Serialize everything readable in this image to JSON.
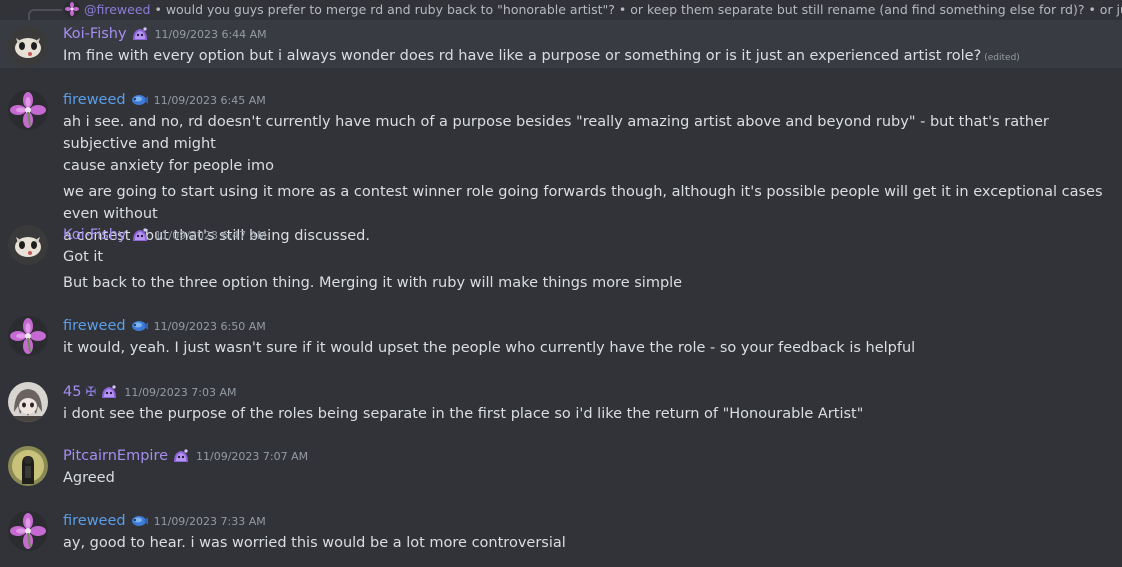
{
  "reply": {
    "author": "@fireweed",
    "text": "• would you guys prefer to merge rd and ruby back to \"honorable artist\"?  • or keep them separate but still rename (and find something else for rd)?  • or just leave it"
  },
  "messages": [
    {
      "author": "Koi-Fishy",
      "timestamp": "11/09/2023 6:44 AM",
      "lines": [
        "Im fine with every option but i always wonder does rd have like a purpose or something or is it just an experienced artist role?"
      ],
      "edited": "(edited)"
    },
    {
      "author": "fireweed",
      "timestamp": "11/09/2023 6:45 AM",
      "lines": [
        "ah i see. and no, rd doesn't currently have much of a purpose besides \"really amazing artist above and beyond ruby\" - but that's rather subjective and might",
        "cause anxiety for people imo",
        "we are going to start using it more as a contest winner role going forwards though, although it's possible people will get it in exceptional cases even without",
        "a contest - but that's still being discussed."
      ]
    },
    {
      "author": "Koi-Fishy",
      "timestamp": "11/09/2023 6:47 AM",
      "lines": [
        "Got it",
        "But back to the three option thing. Merging it with ruby will make things more simple"
      ]
    },
    {
      "author": "fireweed",
      "timestamp": "11/09/2023 6:50 AM",
      "lines": [
        "it would, yeah. I just wasn't sure if it would upset the people who currently have the role - so your feedback is helpful"
      ]
    },
    {
      "author": "45",
      "author_symbol": "✠",
      "timestamp": "11/09/2023 7:03 AM",
      "lines": [
        "i dont see the purpose of the roles being separate in the first place so i'd like the return of \"Honourable Artist\""
      ]
    },
    {
      "author": "PitcairnEmpire",
      "timestamp": "11/09/2023 7:07 AM",
      "lines": [
        "Agreed"
      ]
    },
    {
      "author": "fireweed",
      "timestamp": "11/09/2023 7:33 AM",
      "lines": [
        "ay, good to hear. i was worried this would be a lot more controversial"
      ]
    }
  ],
  "colors": {
    "background": "#313338",
    "highlight": "#393b43",
    "fireweed": "#5b9ee8",
    "koi_fishy": "#a58ef0",
    "timestamp": "#949ba4",
    "text": "#dbdee1"
  },
  "icons": {
    "role_badge_purple": "purple-slime-badge-icon",
    "role_badge_blue": "blue-fish-badge-icon"
  }
}
